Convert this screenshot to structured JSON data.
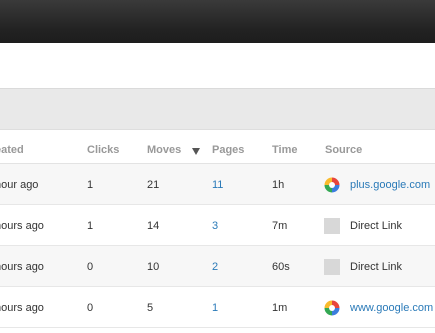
{
  "table": {
    "columns": [
      "eated",
      "Clicks",
      "Moves",
      "Pages",
      "Time",
      "Source"
    ],
    "sort": {
      "column": "Moves",
      "direction": "descending"
    },
    "rows": [
      {
        "created": "hour ago",
        "clicks": "1",
        "moves": "21",
        "pages": "11",
        "time": "1h",
        "source_icon": "google-plus-icon",
        "source": "plus.google.com"
      },
      {
        "created": "hours ago",
        "clicks": "1",
        "moves": "14",
        "pages": "3",
        "time": "7m",
        "source_icon": "blank-icon",
        "source": "Direct Link"
      },
      {
        "created": "hours ago",
        "clicks": "0",
        "moves": "10",
        "pages": "2",
        "time": "60s",
        "source_icon": "blank-icon",
        "source": "Direct Link"
      },
      {
        "created": "hours ago",
        "clicks": "0",
        "moves": "5",
        "pages": "1",
        "time": "1m",
        "source_icon": "google-plus-icon",
        "source": "www.google.com"
      }
    ]
  },
  "colors": {
    "link": "#2a7ab8",
    "header_text": "#999999",
    "topbar": "#222222",
    "toolbar": "#e9e9e9"
  }
}
